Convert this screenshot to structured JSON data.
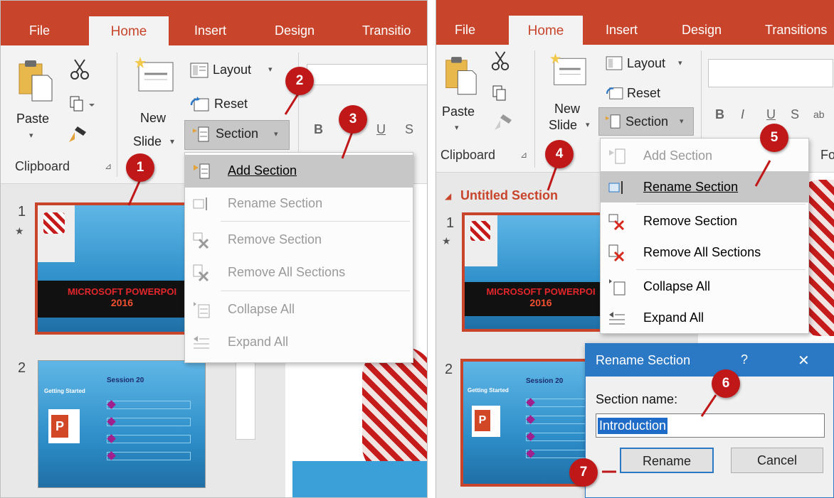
{
  "colors": {
    "accent": "#c8452b",
    "badge": "#c01818",
    "dialog_title": "#2b78c5",
    "selection": "#1f6cc8"
  },
  "left": {
    "tabs": {
      "file": "File",
      "home": "Home",
      "insert": "Insert",
      "design": "Design",
      "transitions": "Transitio"
    },
    "ribbon": {
      "paste": "Paste",
      "new_slide_1": "New",
      "new_slide_2": "Slide",
      "layout": "Layout",
      "reset": "Reset",
      "section": "Section",
      "clipboard": "Clipboard",
      "bold": "B",
      "underline": "U",
      "strike": "S"
    },
    "slides": [
      {
        "number": "1",
        "star": "★",
        "title_line1": "MICROSOFT POWERPOI",
        "title_line2": "2016"
      },
      {
        "number": "2",
        "header": "Session 20",
        "subheader": "Getting Started"
      }
    ],
    "menu": [
      "Add Section",
      "Rename Section",
      "Remove Section",
      "Remove All Sections",
      "Collapse All",
      "Expand All"
    ],
    "badges": [
      "1",
      "2",
      "3"
    ]
  },
  "right": {
    "tabs": {
      "file": "File",
      "home": "Home",
      "insert": "Insert",
      "design": "Design",
      "transitions": "Transitions"
    },
    "ribbon": {
      "paste": "Paste",
      "new_slide_1": "New",
      "new_slide_2": "Slide",
      "layout": "Layout",
      "reset": "Reset",
      "section": "Section",
      "clipboard": "Clipboard",
      "bold": "B",
      "italic": "I",
      "underline": "U",
      "strike": "S",
      "ab": "ab",
      "font_group": "Fo"
    },
    "section_header": "Untitled Section",
    "slides": [
      {
        "number": "1",
        "star": "★",
        "title_line1": "MICROSOFT POWERPOI",
        "title_line2": "2016"
      },
      {
        "number": "2",
        "header": "Session 20",
        "subheader": "Getting Started"
      }
    ],
    "menu": [
      "Add Section",
      "Rename Section",
      "Remove Section",
      "Remove All Sections",
      "Collapse All",
      "Expand All"
    ],
    "badges": [
      "4",
      "5",
      "6",
      "7"
    ]
  },
  "dialog": {
    "title": "Rename Section",
    "help": "?",
    "close": "✕",
    "field_label": "Section name:",
    "field_value": "Introduction",
    "rename_button": "Rename",
    "cancel_button": "Cancel"
  }
}
